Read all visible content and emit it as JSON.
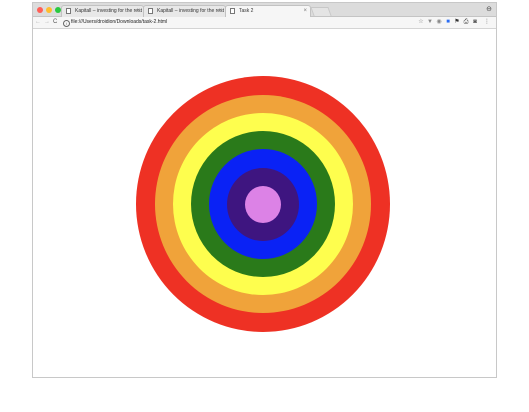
{
  "browser": {
    "tabs": [
      {
        "title": "Kapitall – investing for the rest",
        "active": false
      },
      {
        "title": "Kapitall – investing for the rest",
        "active": false
      },
      {
        "title": "Task 2",
        "active": true
      }
    ],
    "tab_close_glyph": "×",
    "url": "file:///Users/droidion/Downloads/task-2.html",
    "nav": {
      "back": "←",
      "forward": "→",
      "reload": "C"
    },
    "info_glyph": "i",
    "profile_glyph": "⊖",
    "extensions": [
      {
        "icon": "star-icon",
        "glyph": "☆",
        "color": "#777777"
      },
      {
        "icon": "filter-icon",
        "glyph": "▼",
        "color": "#888888"
      },
      {
        "icon": "eye-icon",
        "glyph": "◉",
        "color": "#888888"
      },
      {
        "icon": "blue-extension-icon",
        "glyph": "■",
        "color": "#2a6df4"
      },
      {
        "icon": "pin-extension-icon",
        "glyph": "⚑",
        "color": "#333333"
      },
      {
        "icon": "print-icon",
        "glyph": "⎙",
        "color": "#444444"
      },
      {
        "icon": "camera-icon",
        "glyph": "◙",
        "color": "#555555"
      },
      {
        "icon": "menu-icon",
        "glyph": "⋮",
        "color": "#555555"
      }
    ]
  },
  "target": {
    "rings": [
      {
        "color": "#ee3124"
      },
      {
        "color": "#f0a33a"
      },
      {
        "color": "#fefe4e"
      },
      {
        "color": "#2a7a1a"
      },
      {
        "color": "#0a22f5"
      },
      {
        "color": "#3e1580"
      },
      {
        "color": "#dc82e6"
      }
    ]
  }
}
